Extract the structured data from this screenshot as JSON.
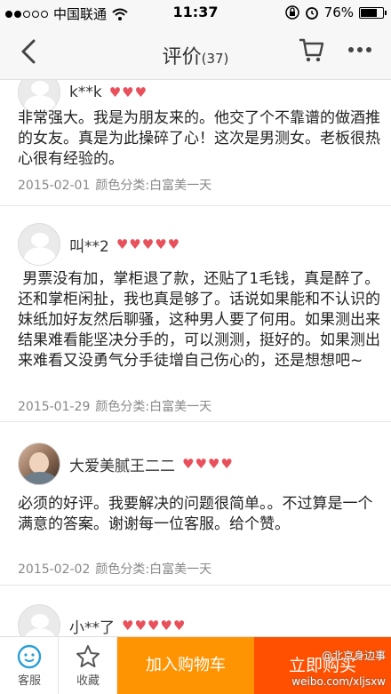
{
  "status": {
    "carrier": "中国联通",
    "time": "11:37",
    "battery": "76%",
    "battery_level": 0.76
  },
  "nav": {
    "title": "评价",
    "count": "(37)"
  },
  "reviews": [
    {
      "user": "k**k",
      "hearts": 3,
      "text": "非常强大。我是为朋友来的。他交了个不靠谱的做酒推的女友。真是为此操碎了心！这次是男测女。老板很热心很有经验的。",
      "date": "2015-02-01",
      "spec": "颜色分类:白富美一天"
    },
    {
      "user": "叫**2",
      "hearts": 5,
      "text": " 男票没有加，掌柜退了款，还贴了1毛钱，真是醉了。还和掌柜闲扯，我也真是够了。话说如果能和不认识的妹纸加好友然后聊骚，这种男人要了何用。如果测出来结果难看能坚决分手的，可以测测，挺好的。如果测出来难看又没勇气分手徒增自己伤心的，还是想想吧~",
      "date": "2015-01-29",
      "spec": "颜色分类:白富美一天"
    },
    {
      "user": "大爱美腻王二二",
      "hearts": 4,
      "text": "必须的好评。我要解决的问题很简单。。不过算是一个满意的答案。谢谢每一位客服。给个赞。",
      "date": "2015-02-02",
      "spec": "颜色分类:白富美一天"
    },
    {
      "user": "小**了",
      "hearts": 5
    }
  ],
  "bottom": {
    "service_label": "客服",
    "favorite_label": "收藏",
    "add_cart_label": "加入购物车",
    "buy_label": "立即购买"
  },
  "watermark": {
    "line1": "@北京身边事",
    "line2": "weibo.com/xljsxw"
  },
  "colors": {
    "accent_cart": "#fe9402",
    "accent_buy": "#fe5000",
    "heart": "#e8505b",
    "service_icon": "#2a9fd6"
  }
}
